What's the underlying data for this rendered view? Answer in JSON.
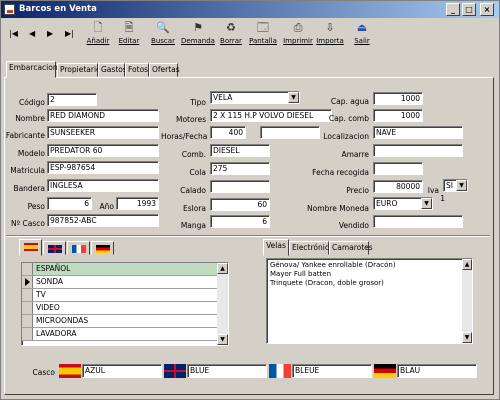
{
  "window": {
    "title": "Barcos en Venta"
  },
  "title_buttons": {
    "minimize": "_",
    "maximize": "□",
    "close": "×"
  },
  "nav": {
    "first": "|◀",
    "prev": "◀",
    "next": "▶",
    "last": "▶|"
  },
  "toolbar": {
    "tools": [
      {
        "label": "Añadir",
        "icon": "add-document-icon",
        "glyph": "🗋"
      },
      {
        "label": "Editar",
        "icon": "edit-document-icon",
        "glyph": "🗎"
      },
      {
        "label": "Buscar",
        "icon": "magnifier-icon",
        "glyph": "🔍"
      },
      {
        "label": "Demanda",
        "icon": "demand-icon",
        "glyph": "⚑"
      },
      {
        "label": "Borrar",
        "icon": "delete-icon",
        "glyph": "♻"
      },
      {
        "label": "Pantalla",
        "icon": "screen-icon",
        "glyph": "🗔"
      },
      {
        "label": "Imprimir",
        "icon": "printer-icon",
        "glyph": "⎙"
      },
      {
        "label": "Importa",
        "icon": "import-icon",
        "glyph": "⇩"
      },
      {
        "label": "Salir",
        "icon": "exit-icon",
        "glyph": "⏏"
      }
    ]
  },
  "tabs": [
    "Embarcacion",
    "Propietario",
    "Gastos",
    "Fotos",
    "Ofertas"
  ],
  "form": {
    "codigo_label": "Código",
    "codigo": "2",
    "nombre_label": "Nombre",
    "nombre": "RED DIAMOND",
    "fabricante_label": "Fabricante",
    "fabricante": "SUNSEEKER",
    "modelo_label": "Modelo",
    "modelo": "PREDATOR 60",
    "matricula_label": "Matricula",
    "matricula": "ESP-987654",
    "bandera_label": "Bandera",
    "bandera": "INGLESA",
    "peso_label": "Peso",
    "peso": "6",
    "ano_label": "Año",
    "ano": "1993",
    "casco_num_label": "Nº Casco",
    "casco_num": "987852-ABC",
    "tipo_label": "Tipo",
    "tipo": "VELA",
    "motores_label": "Motores",
    "motores": "2 X 115 H.P VOLVO DIESEL",
    "horas_label": "Horas/Fecha",
    "horas": "400",
    "horas_fecha": "",
    "comb_label": "Comb.",
    "comb": "DIESEL",
    "cola_label": "Cola",
    "cola": "275",
    "calado_label": "Calado",
    "calado": "",
    "eslora_label": "Eslora",
    "eslora": "60",
    "manga_label": "Manga",
    "manga": "6",
    "cap_agua_label": "Cap. agua",
    "cap_agua": "1000",
    "cap_comb_label": "Cap. comb",
    "cap_comb": "1000",
    "localizacion_label": "Localizacion",
    "localizacion": "NAVE",
    "amarre_label": "Amarre",
    "amarre": "",
    "fecha_recogida_label": "Fecha recogida",
    "fecha_recogida": "",
    "precio_label": "Precio",
    "precio": "80000",
    "iva_label": "Iva",
    "iva": "SI",
    "iva_num": "1",
    "moneda_label": "Nombre Moneda",
    "moneda": "EURO",
    "vendido_label": "Vendido",
    "vendido": ""
  },
  "language_tabs": [
    "es-flag-icon",
    "uk-flag-icon",
    "fr-flag-icon",
    "de-flag-icon"
  ],
  "equipment_list": [
    "ESPAÑOL",
    "SONDA",
    "TV",
    "VIDEO",
    "MICROONDAS",
    "LAVADORA"
  ],
  "sail_tabs": [
    "Velas",
    "Electrónica",
    "Camarotes"
  ],
  "velas_text": [
    "Génova/ Yankee enrollable (Dracón)",
    "Mayor Full batten",
    "Trinquete (Dracon, doble grosor)"
  ],
  "casco": {
    "label": "Casco",
    "es": "AZUL",
    "en": "BLUE",
    "fr": "BLEUE",
    "de": "BLAU"
  }
}
